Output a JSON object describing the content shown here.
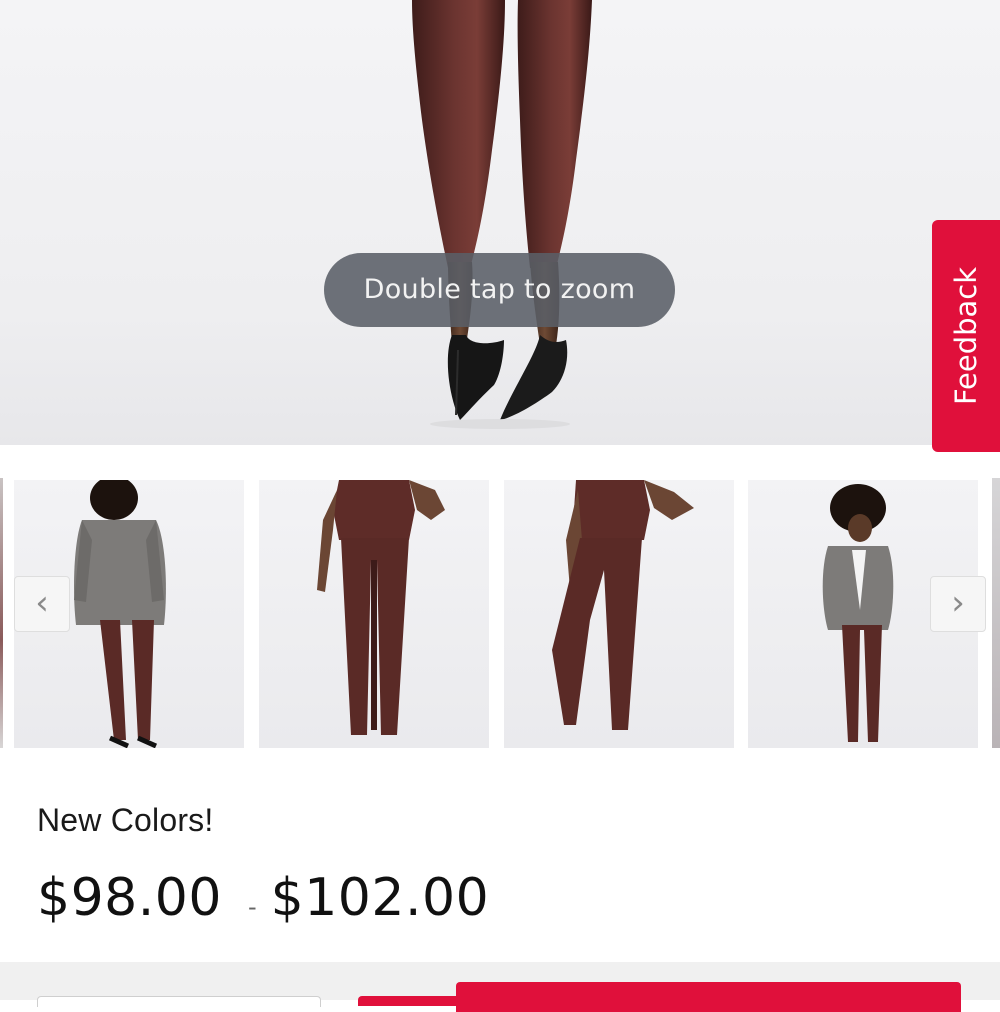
{
  "hero": {
    "zoom_hint": "Double tap to zoom",
    "image_subject": "legs-in-faux-leather-leggings-and-black-heels"
  },
  "feedback": {
    "label": "Feedback",
    "color": "#e0103b"
  },
  "carousel": {
    "prev_icon": "chevron-left-icon",
    "next_icon": "chevron-right-icon",
    "thumbnails": [
      {
        "view": "back-with-blazer"
      },
      {
        "view": "front"
      },
      {
        "view": "three-quarter"
      },
      {
        "view": "front-with-blazer"
      }
    ]
  },
  "product": {
    "promo_text": "New Colors!",
    "price_low": "$98.00",
    "price_separator": "-",
    "price_high": "$102.00"
  },
  "colors": {
    "accent": "#e0103b",
    "legging": "#5a2a26",
    "text": "#111111"
  }
}
